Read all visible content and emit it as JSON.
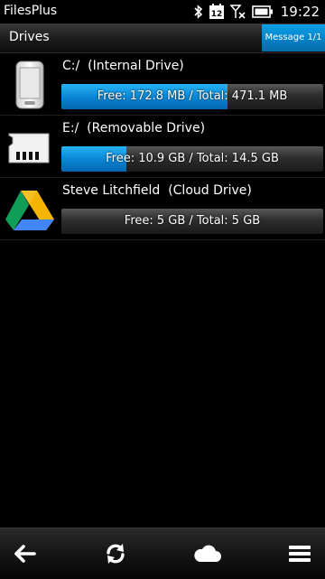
{
  "status_bar": {
    "app_name": "FilesPlus",
    "calendar_day": "12",
    "time": "19:22"
  },
  "header": {
    "title": "Drives",
    "message_badge": "Message 1/1"
  },
  "colors": {
    "accent": "#0a87d6",
    "background": "#000000"
  },
  "drives": [
    {
      "name": "C:/  (Internal Drive)",
      "icon": "phone-icon",
      "usage_text": "Free: 172.8 MB / Total: 471.1 MB",
      "used_fraction": 0.633
    },
    {
      "name": "E:/  (Removable Drive)",
      "icon": "sd-card-icon",
      "usage_text": "Free: 10.9 GB / Total: 14.5 GB",
      "used_fraction": 0.248
    },
    {
      "name": "Steve Litchfield  (Cloud Drive)",
      "icon": "google-drive-icon",
      "usage_text": "Free: 5 GB / Total: 5 GB",
      "used_fraction": 0.0
    }
  ],
  "toolbar": {
    "icons": [
      "back-arrow-icon",
      "refresh-icon",
      "cloud-icon",
      "menu-icon"
    ]
  }
}
